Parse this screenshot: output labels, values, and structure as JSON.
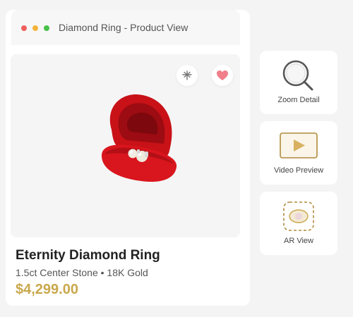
{
  "window": {
    "title": "Diamond Ring - Product View",
    "controls": [
      {
        "name": "close",
        "color": "#ee5f5b"
      },
      {
        "name": "minimize",
        "color": "#f4b43a"
      },
      {
        "name": "zoom",
        "color": "#49c04a"
      }
    ]
  },
  "product": {
    "name": "Eternity Diamond Ring",
    "specs": "1.5ct Center Stone • 18K Gold",
    "price": "$4,299.00",
    "image_icon": "ring-box-icon",
    "actions": [
      {
        "name": "compare",
        "icon": "sparkle-icon"
      },
      {
        "name": "favorite",
        "icon": "heart-icon"
      }
    ]
  },
  "side_actions": [
    {
      "label": "Zoom Detail",
      "icon": "magnifier-icon"
    },
    {
      "label": "Video Preview",
      "icon": "play-icon"
    },
    {
      "label": "AR View",
      "icon": "ar-icon"
    }
  ],
  "colors": {
    "accent_gold": "#c9a84c",
    "heart": "#f07f8a",
    "box_red": "#d9151d"
  }
}
